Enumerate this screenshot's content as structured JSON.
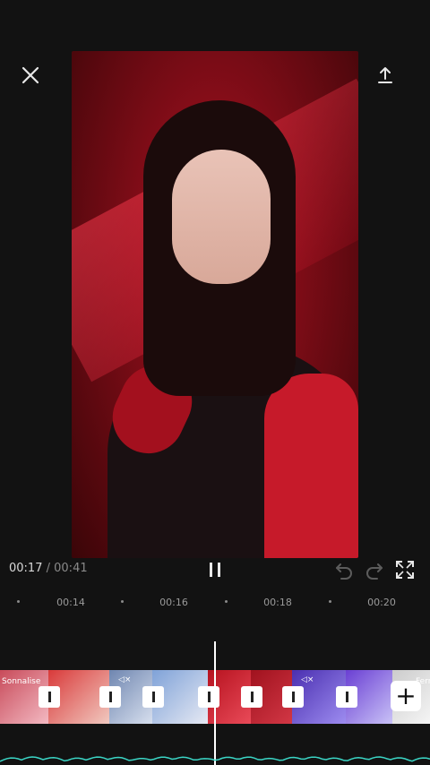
{
  "time": {
    "current": "00:17",
    "separator": "/",
    "total": "00:41"
  },
  "ruler": {
    "labels": [
      "00:14",
      "00:16",
      "00:18",
      "00:20"
    ]
  },
  "clips": [
    {
      "label": "Sonnalise",
      "color1": "#c84b5a",
      "color2": "#f3b9c2"
    },
    {
      "label": "",
      "color1": "#d93a3a",
      "color2": "#f1c9c0"
    },
    {
      "label": "",
      "color1": "#6f86b0",
      "color2": "#d7dfee"
    },
    {
      "label": "",
      "color1": "#7fa2d8",
      "color2": "#e6e9f3"
    },
    {
      "label": "",
      "color1": "#b6121f",
      "color2": "#e94a58"
    },
    {
      "label": "",
      "color1": "#a0121e",
      "color2": "#d23745"
    },
    {
      "label": "",
      "color1": "#4a2fb0",
      "color2": "#9d8cf0"
    },
    {
      "label": "",
      "color1": "#6a3fd3",
      "color2": "#c9c2f7"
    },
    {
      "label": "Ferr",
      "color1": "#cccccc",
      "color2": "#f5f5f5"
    }
  ],
  "icons": {
    "close": "close-icon",
    "export": "upload-icon",
    "pause": "pause-icon",
    "undo": "undo-icon",
    "redo": "redo-icon",
    "fullscreen": "fullscreen-icon",
    "add": "plus-icon"
  },
  "colors": {
    "background": "#121212",
    "accent_audio": "#3bd6c6"
  }
}
